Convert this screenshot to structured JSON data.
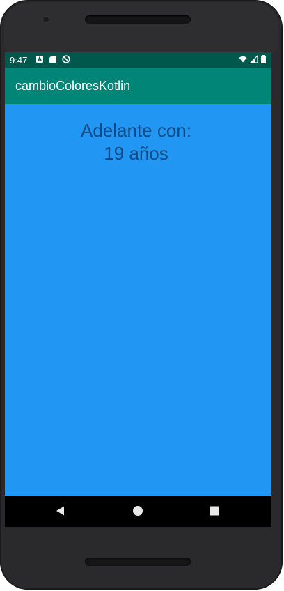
{
  "status_bar": {
    "time": "9:47",
    "left_icons": [
      "a-notification-icon",
      "sd-card-icon",
      "sync-blocked-icon"
    ],
    "right_icons": [
      "wifi-icon",
      "signal-icon",
      "battery-icon"
    ]
  },
  "app_bar": {
    "title": "cambioColoresKotlin"
  },
  "content": {
    "line1": "Adelante con:",
    "line2": "19 años"
  },
  "nav_bar": {
    "buttons": [
      "back-icon",
      "home-icon",
      "recents-icon"
    ]
  },
  "colors": {
    "status_bar": "#00574b",
    "app_bar": "#008577",
    "background": "#2196f3",
    "message_text": "#0d4a86"
  }
}
